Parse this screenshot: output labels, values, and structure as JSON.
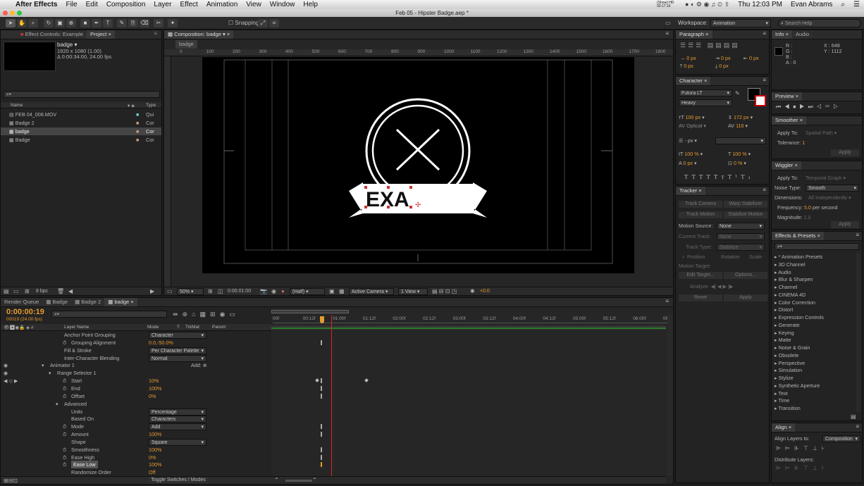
{
  "menubar": {
    "app": "After Effects",
    "items": [
      "File",
      "Edit",
      "Composition",
      "Layer",
      "Effect",
      "Animation",
      "View",
      "Window",
      "Help"
    ],
    "status_small": "(Show) HD 00:17:16",
    "time": "Thu 12:03 PM",
    "user": "Evan Abrams"
  },
  "title": "Feb 05 - Hipster Badge.aep *",
  "toolbar": {
    "snapping": "Snapping",
    "workspace_label": "Workspace:",
    "workspace_value": "Animation",
    "search_placeholder": "Search Help"
  },
  "project": {
    "tab_effects": "Effect Controls: Example",
    "tab_project": "Project",
    "name": "badge",
    "dims": "1920 x 1080 (1.00)",
    "duration": "Δ 0:00:34:00, 24.00 fps",
    "col_name": "Name",
    "col_type": "Type",
    "items": [
      {
        "name": "FEB 04_008.MOV",
        "type": "Qui"
      },
      {
        "name": "Badge 2",
        "type": "Cor"
      },
      {
        "name": "badge",
        "type": "Cor"
      },
      {
        "name": "Badge",
        "type": "Cor"
      }
    ],
    "bpc": "8 bpc"
  },
  "comp": {
    "tab": "Composition: badge",
    "crumb": "badge",
    "ruler": [
      "0",
      "100",
      "200",
      "300",
      "400",
      "500",
      "600",
      "700",
      "800",
      "900",
      "1000",
      "1100",
      "1200",
      "1300",
      "1400",
      "1500",
      "1600",
      "1700",
      "1800",
      "1900"
    ],
    "badge_text": "EXA",
    "zoom": "50%",
    "timecode": "0:00:01:00",
    "res": "(Half)",
    "camera": "Active Camera",
    "view": "1 View",
    "exposure": "+0.0"
  },
  "paragraph": {
    "tab": "Paragraph",
    "px": [
      "0 px",
      "0 px",
      "0 px",
      "0 px",
      "0 px"
    ]
  },
  "character": {
    "tab": "Character",
    "font": "Futura LT",
    "style": "Heavy",
    "size": "100 px",
    "leading": "172 px",
    "kerning": "Optical",
    "tracking": "116",
    "stroke": "- px",
    "vscale": "100 %",
    "hscale": "100 %",
    "baseline": "0 px",
    "tsume": "0 %",
    "styles": [
      "T",
      "T",
      "TT",
      "Tт",
      "T¹",
      "T₁"
    ]
  },
  "tracker": {
    "tab": "Tracker",
    "b1": "Track Camera",
    "b2": "Warp Stabilizer",
    "b3": "Track Motion",
    "b4": "Stabilize Motion",
    "motion_source_label": "Motion Source:",
    "motion_source": "None",
    "current_track_label": "Current Track:",
    "current_track": "None",
    "track_type_label": "Track Type:",
    "track_type": "Stabilize",
    "position": "Position",
    "rotation": "Rotation",
    "scale": "Scale",
    "motion_target": "Motion Target:",
    "edit_target": "Edit Target...",
    "options": "Options...",
    "analyze": "Analyze:",
    "reset": "Reset",
    "apply": "Apply"
  },
  "info": {
    "tab_info": "Info",
    "tab_audio": "Audio",
    "r": "R :",
    "g": "G :",
    "b": "B :",
    "a": "A : 0",
    "x": "X : 648",
    "y": "Y : 1112"
  },
  "preview": {
    "tab": "Preview"
  },
  "smoother": {
    "tab": "Smoother",
    "apply_to_label": "Apply To:",
    "apply_to": "Spatial Path",
    "tolerance_label": "Tolerance:",
    "tolerance": "1",
    "apply": "Apply"
  },
  "wiggler": {
    "tab": "Wiggler",
    "apply_to_label": "Apply To:",
    "apply_to": "Temporal Graph",
    "noise_label": "Noise Type:",
    "noise": "Smooth",
    "dim_label": "Dimensions:",
    "dim": "All Independently",
    "freq_label": "Frequency:",
    "freq": "5.0",
    "freq_unit": "per second",
    "mag_label": "Magnitude:",
    "mag": "1.0",
    "apply": "Apply"
  },
  "effects": {
    "tab": "Effects & Presets",
    "items": [
      "* Animation Presets",
      "3D Channel",
      "Audio",
      "Blur & Sharpen",
      "Channel",
      "CINEMA 4D",
      "Color Correction",
      "Distort",
      "Expression Controls",
      "Generate",
      "Keying",
      "Matte",
      "Noise & Grain",
      "Obsolete",
      "Perspective",
      "Simulation",
      "Stylize",
      "Synthetic Aperture",
      "Text",
      "Time",
      "Transition"
    ]
  },
  "align": {
    "tab": "Align",
    "align_to_label": "Align Layers to:",
    "align_to": "Composition",
    "distribute": "Distribute Layers:"
  },
  "timeline": {
    "tabs": [
      "Render Queue",
      "Badge",
      "Badge 2",
      "badge"
    ],
    "timecode": "0:00:00:19",
    "frames": "00019 (24.00 fps)",
    "col_layer": "Layer Name",
    "col_mode": "Mode",
    "col_t": "T",
    "col_trkmat": "TrkMat",
    "col_parent": "Parent",
    "ruler": [
      "00f",
      "00:12f",
      "01:00f",
      "01:12f",
      "02:00f",
      "02:12f",
      "03:00f",
      "03:12f",
      "04:00f",
      "04:12f",
      "05:00f",
      "05:12f",
      "06:00f",
      "06:1"
    ],
    "toggle": "Toggle Switches / Modes",
    "add": "Add:",
    "props": [
      {
        "name": "Anchor Point Grouping",
        "value": "Character",
        "indent": 0,
        "kind": "drop"
      },
      {
        "name": "Grouping Alignment",
        "value": "0.0,-50.0%",
        "indent": 1,
        "kind": "val",
        "sw": true
      },
      {
        "name": "Fill & Stroke",
        "value": "Per Character Palette",
        "indent": 0,
        "kind": "drop"
      },
      {
        "name": "Inter-Character Blending",
        "value": "Normal",
        "indent": 0,
        "kind": "drop"
      },
      {
        "name": "Animator 1",
        "value": "",
        "indent": -2,
        "kind": "add",
        "tw": true
      },
      {
        "name": "Range Selector 1",
        "value": "",
        "indent": -1,
        "kind": "none",
        "tw": true
      },
      {
        "name": "Start",
        "value": "10%",
        "indent": 1,
        "kind": "val",
        "sw": true
      },
      {
        "name": "End",
        "value": "100%",
        "indent": 1,
        "kind": "val",
        "sw": true
      },
      {
        "name": "Offset",
        "value": "0%",
        "indent": 1,
        "kind": "val",
        "sw": true
      },
      {
        "name": "Advanced",
        "value": "",
        "indent": 0,
        "kind": "none",
        "tw": true
      },
      {
        "name": "Units",
        "value": "Percentage",
        "indent": 1,
        "kind": "drop"
      },
      {
        "name": "Based On",
        "value": "Characters",
        "indent": 1,
        "kind": "drop"
      },
      {
        "name": "Mode",
        "value": "Add",
        "indent": 1,
        "kind": "drop",
        "sw": true
      },
      {
        "name": "Amount",
        "value": "100%",
        "indent": 1,
        "kind": "val",
        "sw": true
      },
      {
        "name": "Shape",
        "value": "Square",
        "indent": 1,
        "kind": "drop"
      },
      {
        "name": "Smoothness",
        "value": "100%",
        "indent": 1,
        "kind": "val",
        "sw": true
      },
      {
        "name": "Ease High",
        "value": "0%",
        "indent": 1,
        "kind": "val",
        "sw": true
      },
      {
        "name": "Ease Low",
        "value": "100%",
        "indent": 1,
        "kind": "val",
        "sw": true,
        "sel": true
      },
      {
        "name": "Randomize Order",
        "value": "Off",
        "indent": 1,
        "kind": "val"
      }
    ]
  }
}
